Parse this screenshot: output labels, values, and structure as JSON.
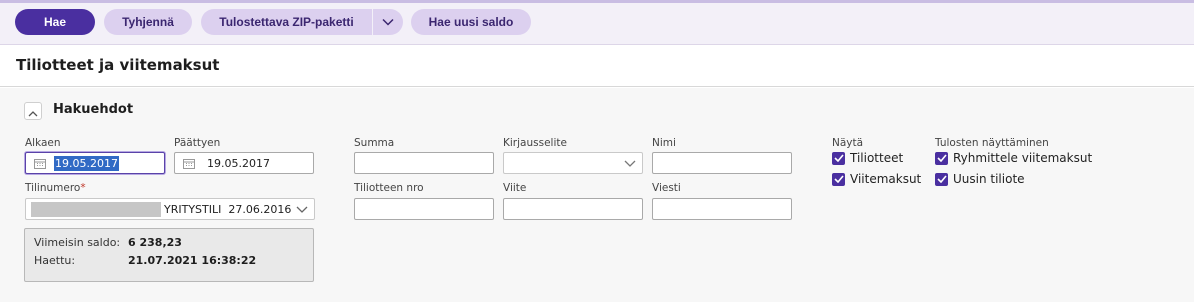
{
  "toolbar": {
    "search_label": "Hae",
    "clear_label": "Tyhjennä",
    "zip_label": "Tulostettava ZIP-paketti",
    "refresh_balance_label": "Hae uusi saldo"
  },
  "page": {
    "title": "Tiliotteet ja viitemaksut"
  },
  "criteria": {
    "section_title": "Hakuehdot",
    "start_label": "Alkaen",
    "start_value": "19.05.2017",
    "end_label": "Päättyen",
    "end_value": "19.05.2017",
    "account_label": "Tilinumero",
    "account_required": "*",
    "account_value": "YRITYSTILI  27.06.2016",
    "amount_label": "Summa",
    "entry_type_label": "Kirjausselite",
    "name_label": "Nimi",
    "statement_no_label": "Tiliotteen nro",
    "reference_label": "Viite",
    "message_label": "Viesti"
  },
  "balance": {
    "latest_label": "Viimeisin saldo:",
    "latest_value": "6 238,23",
    "fetched_label": "Haettu:",
    "fetched_value": "21.07.2021 16:38:22"
  },
  "show": {
    "heading": "Näytä",
    "options": [
      {
        "label": "Tiliotteet",
        "checked": true
      },
      {
        "label": "Viitemaksut",
        "checked": true
      }
    ]
  },
  "printing": {
    "heading": "Tulosten näyttäminen",
    "options": [
      {
        "label": "Ryhmittele viitemaksut",
        "checked": true
      },
      {
        "label": "Uusin tiliote",
        "checked": true
      }
    ]
  },
  "colors": {
    "accent": "#4a2fa0",
    "pill": "#dcd0ef",
    "toolbar_bg": "#f3f0f8"
  }
}
